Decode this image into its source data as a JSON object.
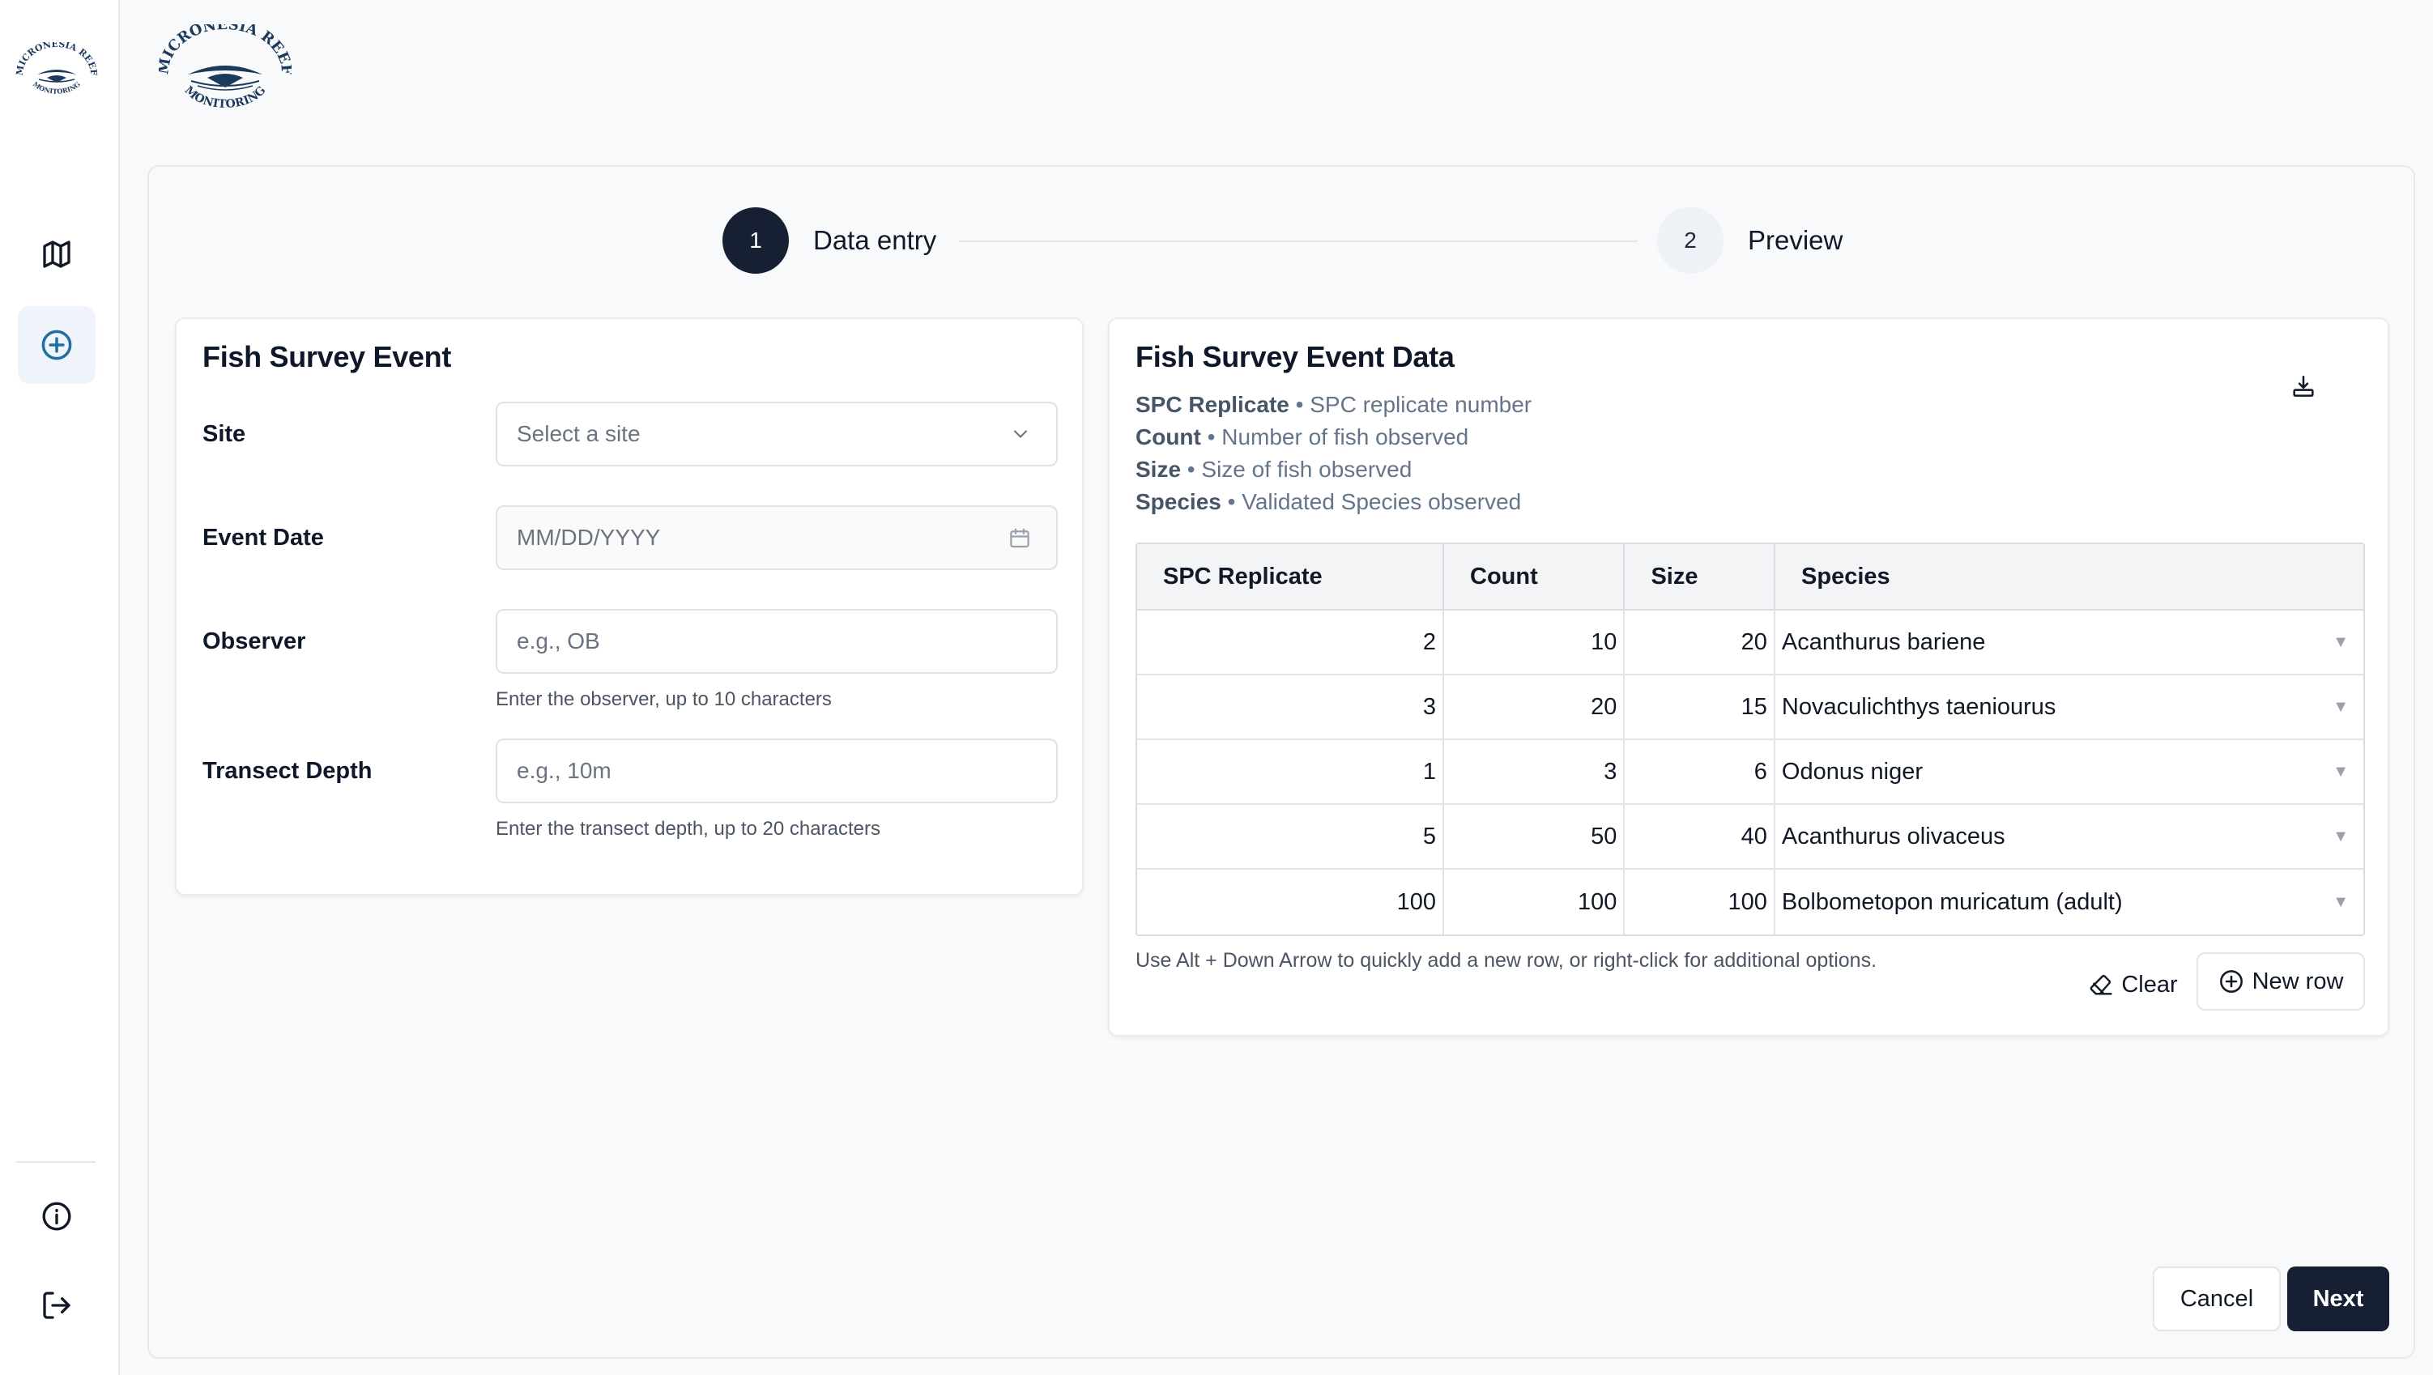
{
  "branding": {
    "logo_top_text": "MICRONESIA REEF",
    "logo_bottom_text": "MONITORING"
  },
  "sidebar": {
    "items": [
      {
        "icon": "map-icon"
      },
      {
        "icon": "plus-circle-icon",
        "active": true
      },
      {
        "icon": "info-icon"
      },
      {
        "icon": "logout-icon"
      }
    ]
  },
  "stepper": {
    "steps": [
      {
        "number": "1",
        "label": "Data entry",
        "active": true
      },
      {
        "number": "2",
        "label": "Preview",
        "active": false
      }
    ]
  },
  "event_form": {
    "title": "Fish Survey Event",
    "site": {
      "label": "Site",
      "placeholder": "Select a site"
    },
    "event_date": {
      "label": "Event Date",
      "placeholder": "MM/DD/YYYY"
    },
    "observer": {
      "label": "Observer",
      "placeholder": "e.g., OB",
      "hint": "Enter the observer, up to 10 characters"
    },
    "transect_depth": {
      "label": "Transect Depth",
      "placeholder": "e.g., 10m",
      "hint": "Enter the transect depth, up to 20 characters"
    }
  },
  "event_data": {
    "title": "Fish Survey Event Data",
    "legend": [
      {
        "term": "SPC Replicate",
        "desc": " • SPC replicate number"
      },
      {
        "term": "Count",
        "desc": " • Number of fish observed"
      },
      {
        "term": "Size",
        "desc": " • Size of fish observed"
      },
      {
        "term": "Species",
        "desc": " • Validated Species observed"
      }
    ],
    "columns": [
      "SPC Replicate",
      "Count",
      "Size",
      "Species"
    ],
    "rows": [
      {
        "replicate": "2",
        "count": "10",
        "size": "20",
        "species": "Acanthurus bariene"
      },
      {
        "replicate": "3",
        "count": "20",
        "size": "15",
        "species": "Novaculichthys taeniourus"
      },
      {
        "replicate": "1",
        "count": "3",
        "size": "6",
        "species": "Odonus niger"
      },
      {
        "replicate": "5",
        "count": "50",
        "size": "40",
        "species": "Acanthurus olivaceus"
      },
      {
        "replicate": "100",
        "count": "100",
        "size": "100",
        "species": "Bolbometopon muricatum (adult)"
      }
    ],
    "footnote": "Use Alt + Down Arrow to quickly add a new row, or right-click for additional options.",
    "clear_label": "Clear",
    "new_row_label": "New row"
  },
  "footer": {
    "cancel_label": "Cancel",
    "next_label": "Next"
  },
  "colors": {
    "primary": "#172033",
    "accent": "#1f6f9f",
    "active_nav_bg": "#eef4f9"
  }
}
